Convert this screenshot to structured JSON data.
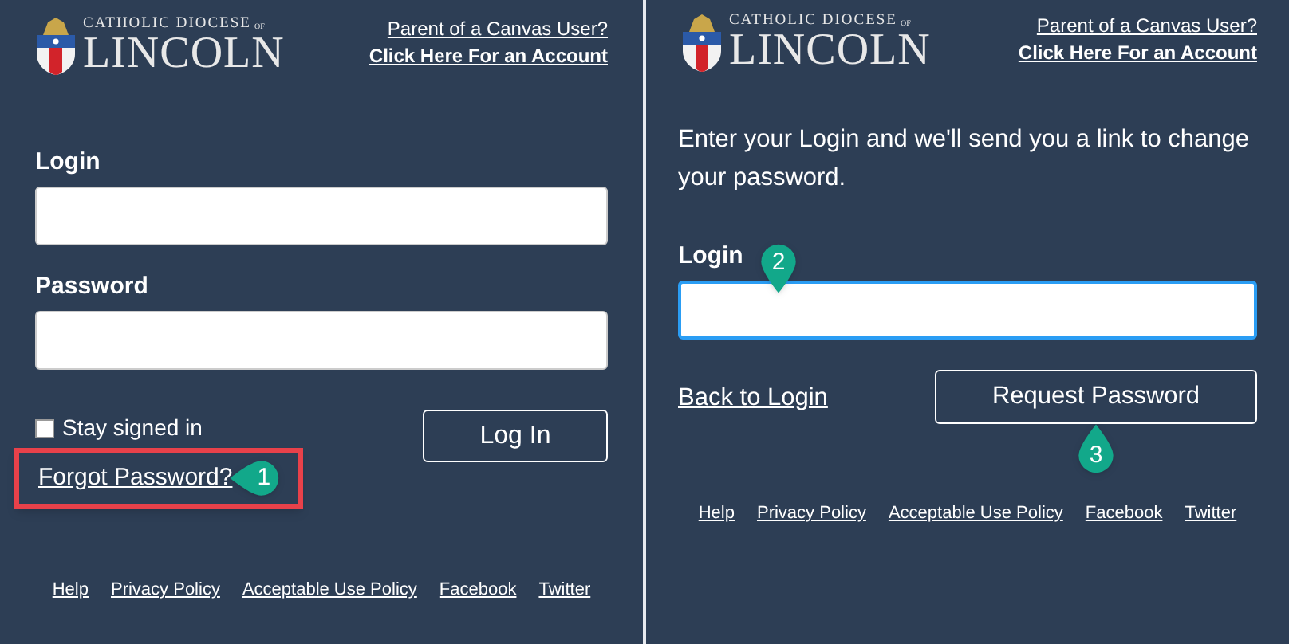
{
  "panels": [
    {
      "logo": {
        "top": "CATHOLIC DIOCESE",
        "of": "OF",
        "name": "LINCOLN"
      },
      "parent_link": "Parent of a Canvas User?",
      "account_link": "Click Here For an Account",
      "form": {
        "kind": "login",
        "fields": [
          {
            "label": "Login",
            "focused": false
          },
          {
            "label": "Password",
            "focused": false
          }
        ],
        "stay_signed_in": {
          "label": "Stay signed in",
          "checked": false
        },
        "forgot": {
          "label": "Forgot Password?",
          "highlighted": true,
          "step": "1"
        },
        "button": "Log In"
      },
      "footer": [
        "Help",
        "Privacy Policy",
        "Acceptable Use Policy",
        "Facebook",
        "Twitter"
      ]
    },
    {
      "logo": {
        "top": "CATHOLIC DIOCESE",
        "of": "OF",
        "name": "LINCOLN"
      },
      "parent_link": "Parent of a Canvas User?",
      "account_link": "Click Here For an Account",
      "form": {
        "kind": "reset",
        "intro": "Enter your Login and we'll send you a link to change your password.",
        "fields": [
          {
            "label": "Login",
            "focused": true,
            "step": "2"
          }
        ],
        "back": "Back to Login",
        "button": "Request Password",
        "button_step": "3"
      },
      "footer": [
        "Help",
        "Privacy Policy",
        "Acceptable Use Policy",
        "Facebook",
        "Twitter"
      ]
    }
  ]
}
